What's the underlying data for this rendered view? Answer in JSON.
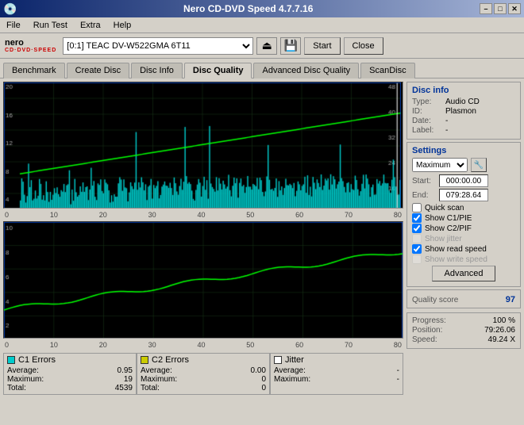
{
  "titlebar": {
    "icon": "●",
    "title": "Nero CD-DVD Speed 4.7.7.16",
    "minimize": "–",
    "maximize": "□",
    "close": "✕"
  },
  "menubar": {
    "items": [
      "File",
      "Run Test",
      "Extra",
      "Help"
    ]
  },
  "toolbar": {
    "drive_value": "[0:1]  TEAC DV-W522GMA 6T11",
    "start_label": "Start",
    "close_label": "Close"
  },
  "tabs": [
    {
      "label": "Benchmark",
      "active": false
    },
    {
      "label": "Create Disc",
      "active": false
    },
    {
      "label": "Disc Info",
      "active": false
    },
    {
      "label": "Disc Quality",
      "active": true
    },
    {
      "label": "Advanced Disc Quality",
      "active": false
    },
    {
      "label": "ScanDisc",
      "active": false
    }
  ],
  "disc_info": {
    "title": "Disc info",
    "type_label": "Type:",
    "type_value": "Audio CD",
    "id_label": "ID:",
    "id_value": "Plasmon",
    "date_label": "Date:",
    "date_value": "-",
    "label_label": "Label:",
    "label_value": "-"
  },
  "settings": {
    "title": "Settings",
    "speed_label": "Maximum",
    "start_label": "Start:",
    "start_value": "000:00.00",
    "end_label": "End:",
    "end_value": "079:28.64"
  },
  "checkboxes": {
    "quick_scan": {
      "label": "Quick scan",
      "checked": false,
      "enabled": true
    },
    "show_c1_pie": {
      "label": "Show C1/PIE",
      "checked": true,
      "enabled": true
    },
    "show_c2_pif": {
      "label": "Show C2/PIF",
      "checked": true,
      "enabled": true
    },
    "show_jitter": {
      "label": "Show jitter",
      "checked": false,
      "enabled": false
    },
    "show_read_speed": {
      "label": "Show read speed",
      "checked": true,
      "enabled": true
    },
    "show_write_speed": {
      "label": "Show write speed",
      "checked": false,
      "enabled": false
    }
  },
  "advanced_button": "Advanced",
  "quality": {
    "score_label": "Quality score",
    "score_value": "97"
  },
  "progress": {
    "progress_label": "Progress:",
    "progress_value": "100 %",
    "position_label": "Position:",
    "position_value": "79:26.06",
    "speed_label": "Speed:",
    "speed_value": "49.24 X"
  },
  "legend": {
    "c1": {
      "title": "C1 Errors",
      "color": "#00cccc",
      "avg_label": "Average:",
      "avg_value": "0.95",
      "max_label": "Maximum:",
      "max_value": "19",
      "total_label": "Total:",
      "total_value": "4539"
    },
    "c2": {
      "title": "C2 Errors",
      "color": "#cccc00",
      "avg_label": "Average:",
      "avg_value": "0.00",
      "max_label": "Maximum:",
      "max_value": "0",
      "total_label": "Total:",
      "total_value": "0"
    },
    "jitter": {
      "title": "Jitter",
      "color": "#ffffff",
      "avg_label": "Average:",
      "avg_value": "-",
      "max_label": "Maximum:",
      "max_value": "-",
      "total_label": "",
      "total_value": ""
    }
  },
  "main_chart": {
    "y_labels": [
      "40",
      "32",
      "24",
      "16",
      "8"
    ],
    "y_labels_left": [
      "20",
      "16",
      "12",
      "8",
      "4"
    ],
    "x_labels": [
      "0",
      "10",
      "20",
      "30",
      "40",
      "50",
      "60",
      "70",
      "80"
    ]
  },
  "sub_chart": {
    "y_labels": [
      "10",
      "8",
      "6",
      "4",
      "2"
    ],
    "x_labels": [
      "0",
      "10",
      "20",
      "30",
      "40",
      "50",
      "60",
      "70",
      "80"
    ]
  }
}
